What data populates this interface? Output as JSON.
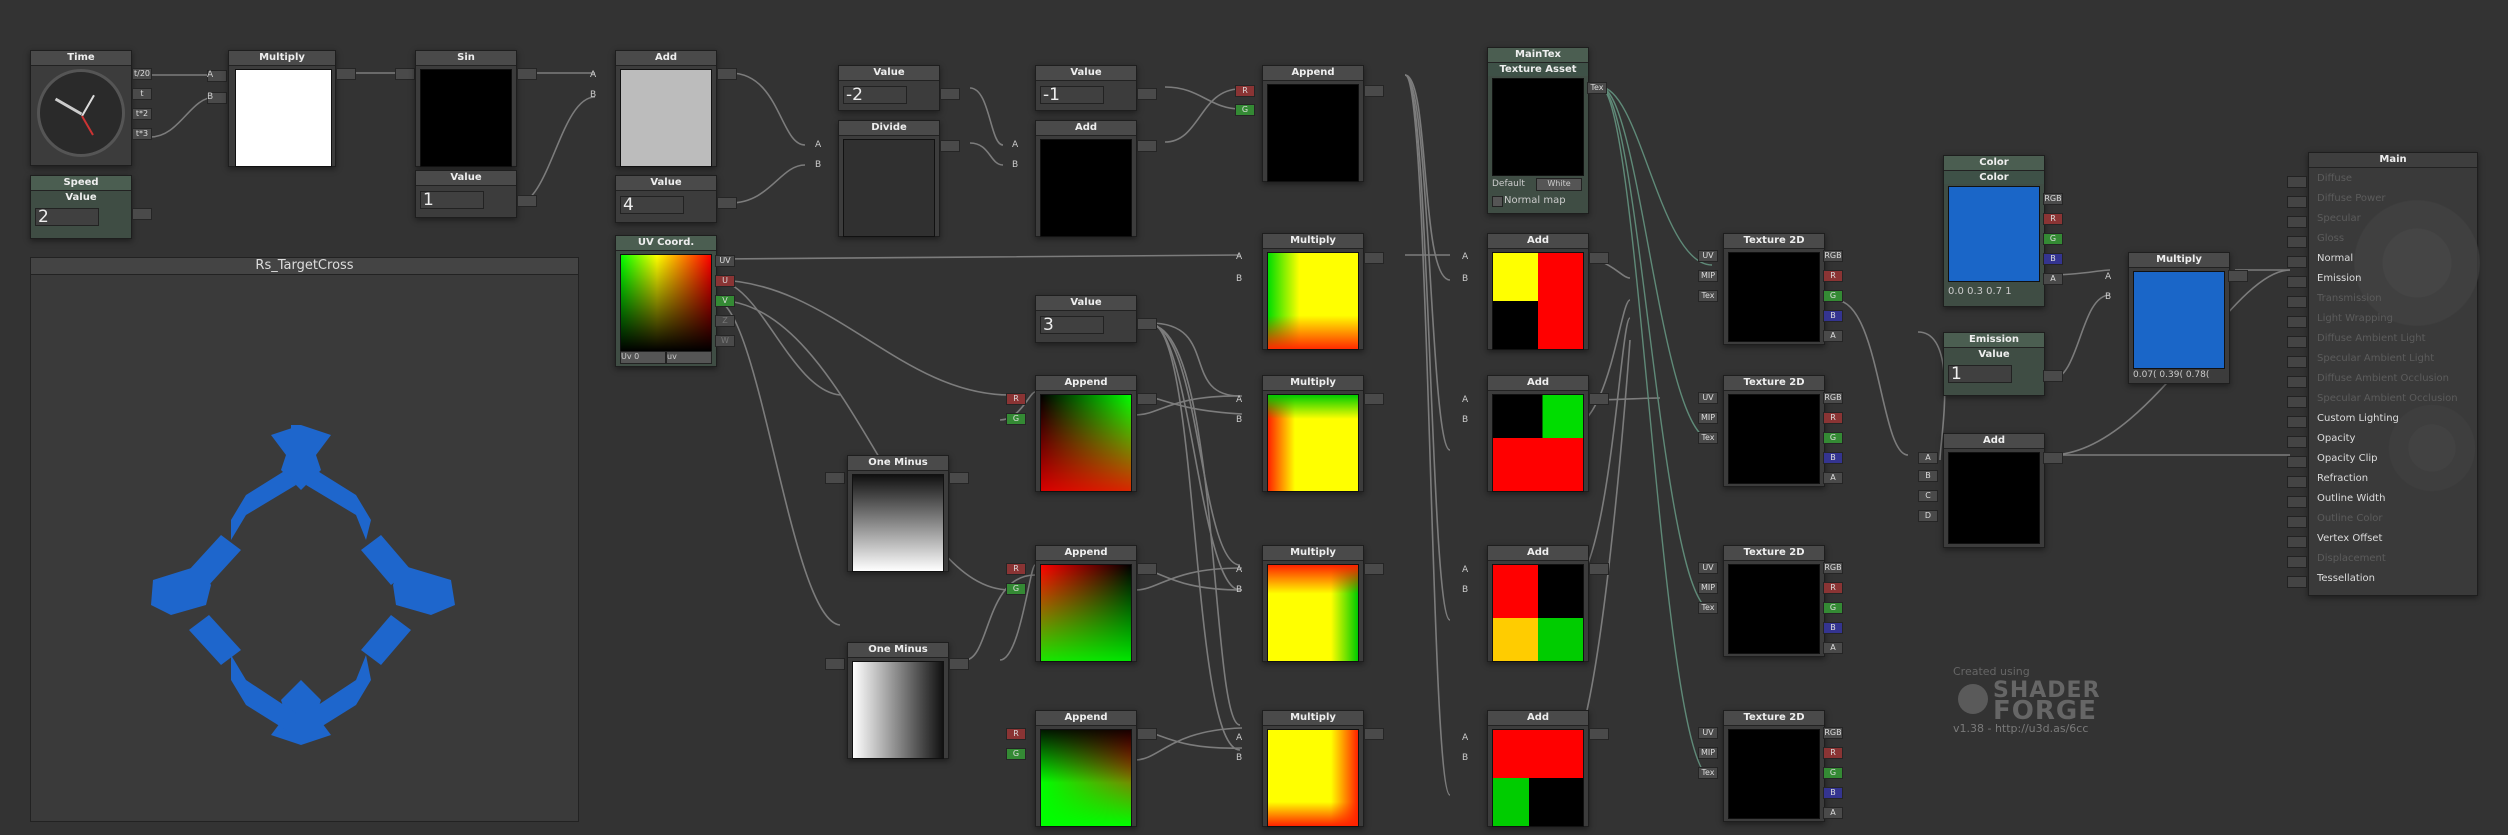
{
  "preview_panel": {
    "title": "Rs_TargetCross"
  },
  "nodes": {
    "time": {
      "title": "Time",
      "outputs": [
        "t/20",
        "t",
        "t*2",
        "t*3"
      ]
    },
    "speed": {
      "title": "Speed",
      "subtitle": "Value",
      "value": "2"
    },
    "multiply1": {
      "title": "Multiply"
    },
    "sin": {
      "title": "Sin"
    },
    "value1": {
      "title": "Value",
      "value": "1"
    },
    "add1": {
      "title": "Add"
    },
    "value4": {
      "title": "Value",
      "value": "4"
    },
    "value_m2": {
      "title": "Value",
      "value": "-2"
    },
    "divide": {
      "title": "Divide"
    },
    "value_m1": {
      "title": "Value",
      "value": "-1"
    },
    "add2": {
      "title": "Add"
    },
    "append_top": {
      "title": "Append"
    },
    "uvcoord": {
      "title": "UV Coord.",
      "outputs": [
        "UV",
        "U",
        "V",
        "Z",
        "W"
      ],
      "uv_label": "Uv 0",
      "uv_select": "uv"
    },
    "value3": {
      "title": "Value",
      "value": "3"
    },
    "oneminus1": {
      "title": "One Minus"
    },
    "oneminus2": {
      "title": "One Minus"
    },
    "append_rows": [
      {
        "title": "Append"
      },
      {
        "title": "Append"
      },
      {
        "title": "Append"
      }
    ],
    "multiply_rows": [
      {
        "title": "Multiply"
      },
      {
        "title": "Multiply"
      },
      {
        "title": "Multiply"
      },
      {
        "title": "Multiply"
      }
    ],
    "add_rows": [
      {
        "title": "Add"
      },
      {
        "title": "Add"
      },
      {
        "title": "Add"
      },
      {
        "title": "Add"
      }
    ],
    "maintex": {
      "title": "MainTex",
      "subtitle": "Texture Asset",
      "output": "Tex",
      "default_label": "Default",
      "default_select": "White",
      "normal_map": "Normal map"
    },
    "tex2d": [
      {
        "title": "Texture 2D"
      },
      {
        "title": "Texture 2D"
      },
      {
        "title": "Texture 2D"
      },
      {
        "title": "Texture 2D"
      }
    ],
    "tex2d_inputs": [
      "UV",
      "MIP",
      "Tex"
    ],
    "tex2d_outputs": [
      "RGB",
      "R",
      "G",
      "B",
      "A"
    ],
    "color": {
      "title": "Color",
      "subtitle": "Color",
      "outputs": [
        "RGB",
        "R",
        "G",
        "B",
        "A"
      ],
      "values": "0.0  0.3  0.7  1",
      "swatch": "#1a66c8"
    },
    "emission": {
      "title": "Emission",
      "subtitle": "Value",
      "value": "1"
    },
    "multiply_final": {
      "title": "Multiply",
      "values": "0.07( 0.39( 0.78("
    },
    "add_final": {
      "title": "Add",
      "inputs": [
        "A",
        "B",
        "C",
        "D"
      ]
    },
    "binputs": {
      "a": "A",
      "b": "B"
    }
  },
  "main_node": {
    "title": "Main",
    "rows": [
      {
        "label": "Diffuse",
        "active": false
      },
      {
        "label": "Diffuse Power",
        "active": false
      },
      {
        "label": "Specular",
        "active": false
      },
      {
        "label": "Gloss",
        "active": false
      },
      {
        "label": "Normal",
        "active": true
      },
      {
        "label": "Emission",
        "active": true
      },
      {
        "label": "Transmission",
        "active": false
      },
      {
        "label": "Light Wrapping",
        "active": false
      },
      {
        "label": "Diffuse Ambient Light",
        "active": false
      },
      {
        "label": "Specular Ambient Light",
        "active": false
      },
      {
        "label": "Diffuse Ambient Occlusion",
        "active": false
      },
      {
        "label": "Specular Ambient Occlusion",
        "active": false
      },
      {
        "label": "Custom Lighting",
        "active": true
      },
      {
        "label": "Opacity",
        "active": true
      },
      {
        "label": "Opacity Clip",
        "active": true
      },
      {
        "label": "Refraction",
        "active": true
      },
      {
        "label": "Outline Width",
        "active": true
      },
      {
        "label": "Outline Color",
        "active": false
      },
      {
        "label": "Vertex Offset",
        "active": true
      },
      {
        "label": "Displacement",
        "active": false
      },
      {
        "label": "Tessellation",
        "active": true
      }
    ]
  },
  "watermark": {
    "created": "Created using",
    "line1": "SHADER",
    "line2": "FORGE",
    "version": "v1.38 - http://u3d.as/6cc"
  }
}
